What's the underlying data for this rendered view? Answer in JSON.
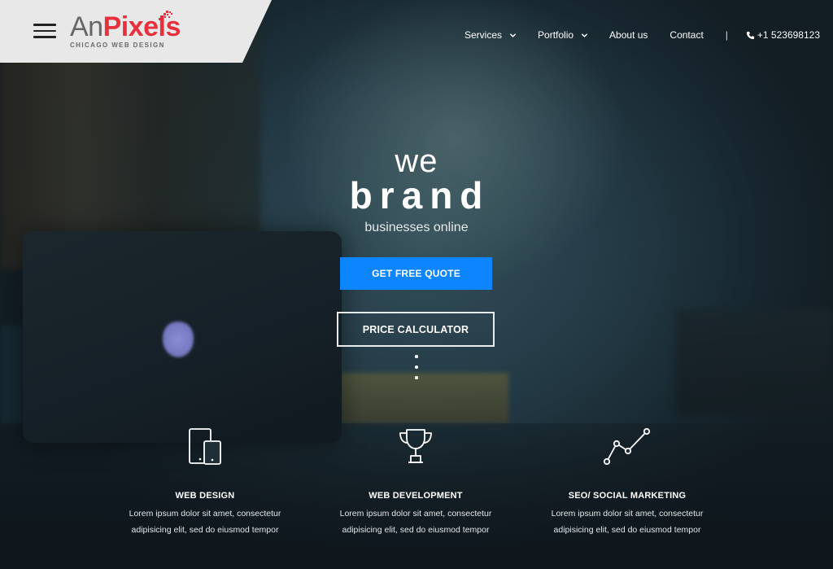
{
  "header": {
    "logo": {
      "part1": "An",
      "part2": "Pixels",
      "tagline": "CHICAGO WEB DESIGN",
      "colors": {
        "grey": "#666666",
        "red": "#e8313c"
      }
    },
    "menu_icon": "hamburger-icon",
    "nav": {
      "services": "Services",
      "portfolio": "Portfolio",
      "about": "About us",
      "contact": "Contact",
      "separator": "|",
      "phone": "+1 523698123",
      "phone_icon": "phone-icon",
      "dropdown_icon": "chevron-down-icon"
    }
  },
  "hero": {
    "line1": "we",
    "line2": "brand",
    "line3": "businesses online",
    "cta_primary": "GET FREE QUOTE",
    "cta_secondary": "PRICE CALCULATOR",
    "scroll_icon": "scroll-dots-icon",
    "accent_color": "#0d85ff"
  },
  "services": [
    {
      "icon": "devices-icon",
      "title": "WEB DESIGN",
      "desc_line1": "Lorem ipsum dolor sit amet, consectetur",
      "desc_line2": "adipisicing elit, sed do eiusmod tempor"
    },
    {
      "icon": "trophy-icon",
      "title": "WEB DEVELOPMENT",
      "desc_line1": "Lorem ipsum dolor sit amet, consectetur",
      "desc_line2": "adipisicing elit, sed do eiusmod tempor"
    },
    {
      "icon": "line-chart-icon",
      "title": "SEO/ SOCIAL MARKETING",
      "desc_line1": "Lorem ipsum dolor sit amet, consectetur",
      "desc_line2": "adipisicing elit, sed do eiusmod tempor"
    }
  ]
}
